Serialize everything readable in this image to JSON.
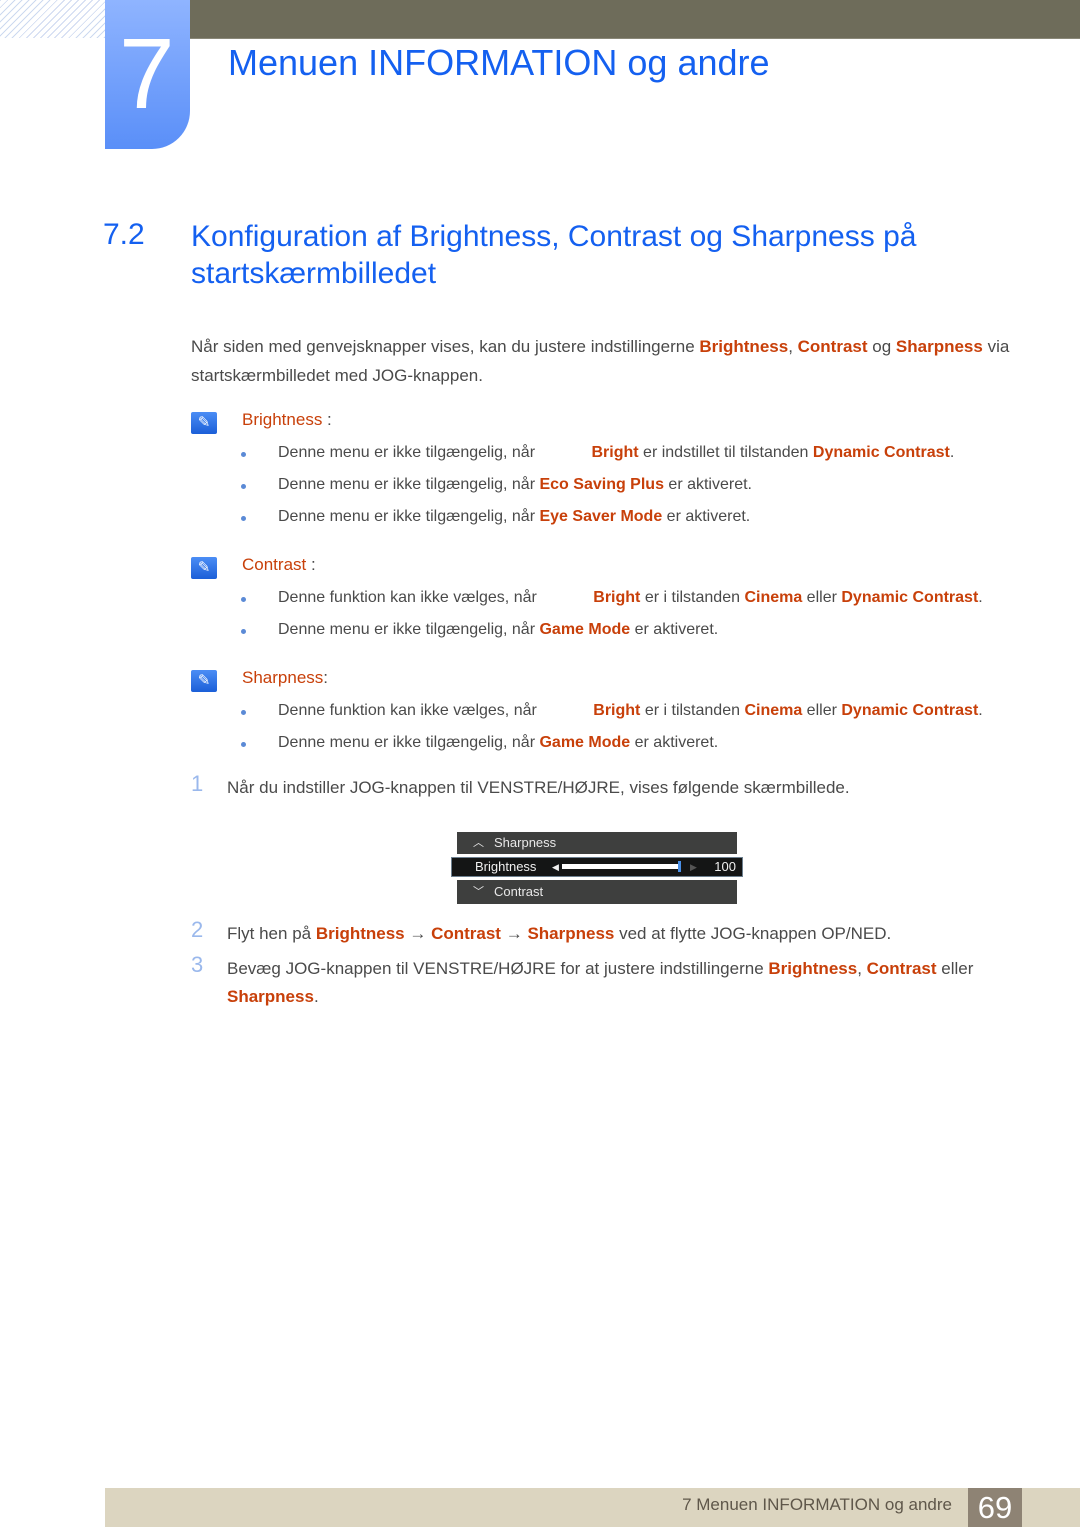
{
  "chapter": {
    "number": "7",
    "title": "Menuen INFORMATION og andre"
  },
  "section": {
    "number": "7.2",
    "title": "Konfiguration af Brightness, Contrast og Sharpness på startskærmbilledet"
  },
  "intro": {
    "t1": "Når siden med genvejsknapper vises, kan du justere indstillingerne ",
    "h1": "Brightness",
    "t2": ", ",
    "h2": "Contrast",
    "t3": " og ",
    "h3": "Sharpness",
    "t4": " via startskærmbilledet med JOG-knappen."
  },
  "notes": [
    {
      "label": "Brightness",
      "suffix": " :",
      "bullets": [
        {
          "pre": "Denne menu er ikke tilgængelig, når ",
          "gap": true,
          "h1": "Bright",
          "mid": " er indstillet til tilstanden ",
          "h2": "Dynamic Contrast",
          "post": "."
        },
        {
          "pre": "Denne menu er ikke tilgængelig, når ",
          "h1": "Eco Saving Plus",
          "mid": " er aktiveret."
        },
        {
          "pre": "Denne menu er ikke tilgængelig, når ",
          "h1": "Eye Saver Mode",
          "mid": " er aktiveret."
        }
      ]
    },
    {
      "label": "Contrast",
      "suffix": " :",
      "bullets": [
        {
          "pre": "Denne funktion kan ikke vælges, når ",
          "gap": true,
          "h1": "Bright",
          "mid": " er i tilstanden ",
          "h2": "Cinema",
          "mid2": " eller ",
          "h3": "Dynamic Contrast",
          "post": "."
        },
        {
          "pre": "Denne menu er ikke tilgængelig, når ",
          "h1": "Game Mode",
          "mid": " er aktiveret."
        }
      ]
    },
    {
      "label": "Sharpness",
      "suffix": ":",
      "bullets": [
        {
          "pre": "Denne funktion kan ikke vælges, når ",
          "gap": true,
          "h1": "Bright",
          "mid": " er i tilstanden ",
          "h2": "Cinema",
          "mid2": " eller ",
          "h3": "Dynamic Contrast",
          "post": "."
        },
        {
          "pre": "Denne menu er ikke tilgængelig, når ",
          "h1": "Game Mode",
          "mid": " er aktiveret."
        }
      ]
    }
  ],
  "steps": [
    {
      "n": "1",
      "text": "Når du indstiller JOG-knappen til VENSTRE/HØJRE, vises følgende skærmbillede."
    },
    {
      "n": "2",
      "t1": "Flyt hen på ",
      "h1": "Brightness",
      "a1": " → ",
      "h2": "Contrast",
      "a2": " → ",
      "h3": "Sharpness",
      "t2": " ved at flytte JOG-knappen OP/NED."
    },
    {
      "n": "3",
      "t1": "Bevæg JOG-knappen til VENSTRE/HØJRE for at justere indstillingerne ",
      "h1": "Brightness",
      "t2": ", ",
      "h2": "Contrast",
      "t3": " eller ",
      "h3": "Sharpness",
      "t4": "."
    }
  ],
  "osd": {
    "up": "Sharpness",
    "selected": "Brightness",
    "value": "100",
    "level_percent": 100,
    "down": "Contrast",
    "up_icon": "^",
    "down_icon": "v"
  },
  "footer": {
    "text": "7 Menuen INFORMATION og andre",
    "page": "69"
  }
}
